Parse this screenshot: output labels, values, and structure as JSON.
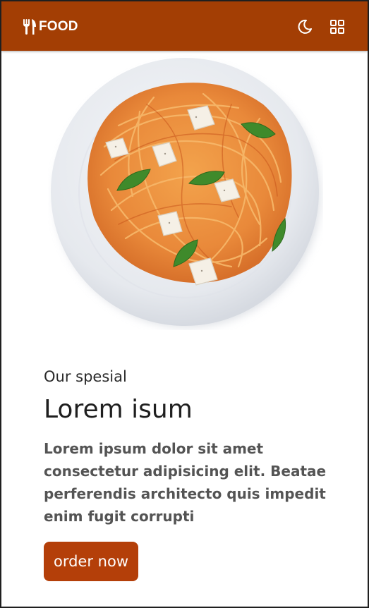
{
  "header": {
    "logo_text": "FOOD",
    "logo_icon": "utensils-icon",
    "theme_toggle_icon": "moon-icon",
    "menu_icon": "grid-icon",
    "background_color": "#a33e04"
  },
  "hero": {
    "image": "spaghetti-plate-image"
  },
  "content": {
    "eyebrow": "Our spesial",
    "title": "Lorem isum",
    "description": "Lorem ipsum dolor sit amet consectetur adipisicing elit. Beatae perferendis architecto quis impedit enim fugit corrupti",
    "order_button_label": "order now",
    "button_color": "#b43f09"
  }
}
